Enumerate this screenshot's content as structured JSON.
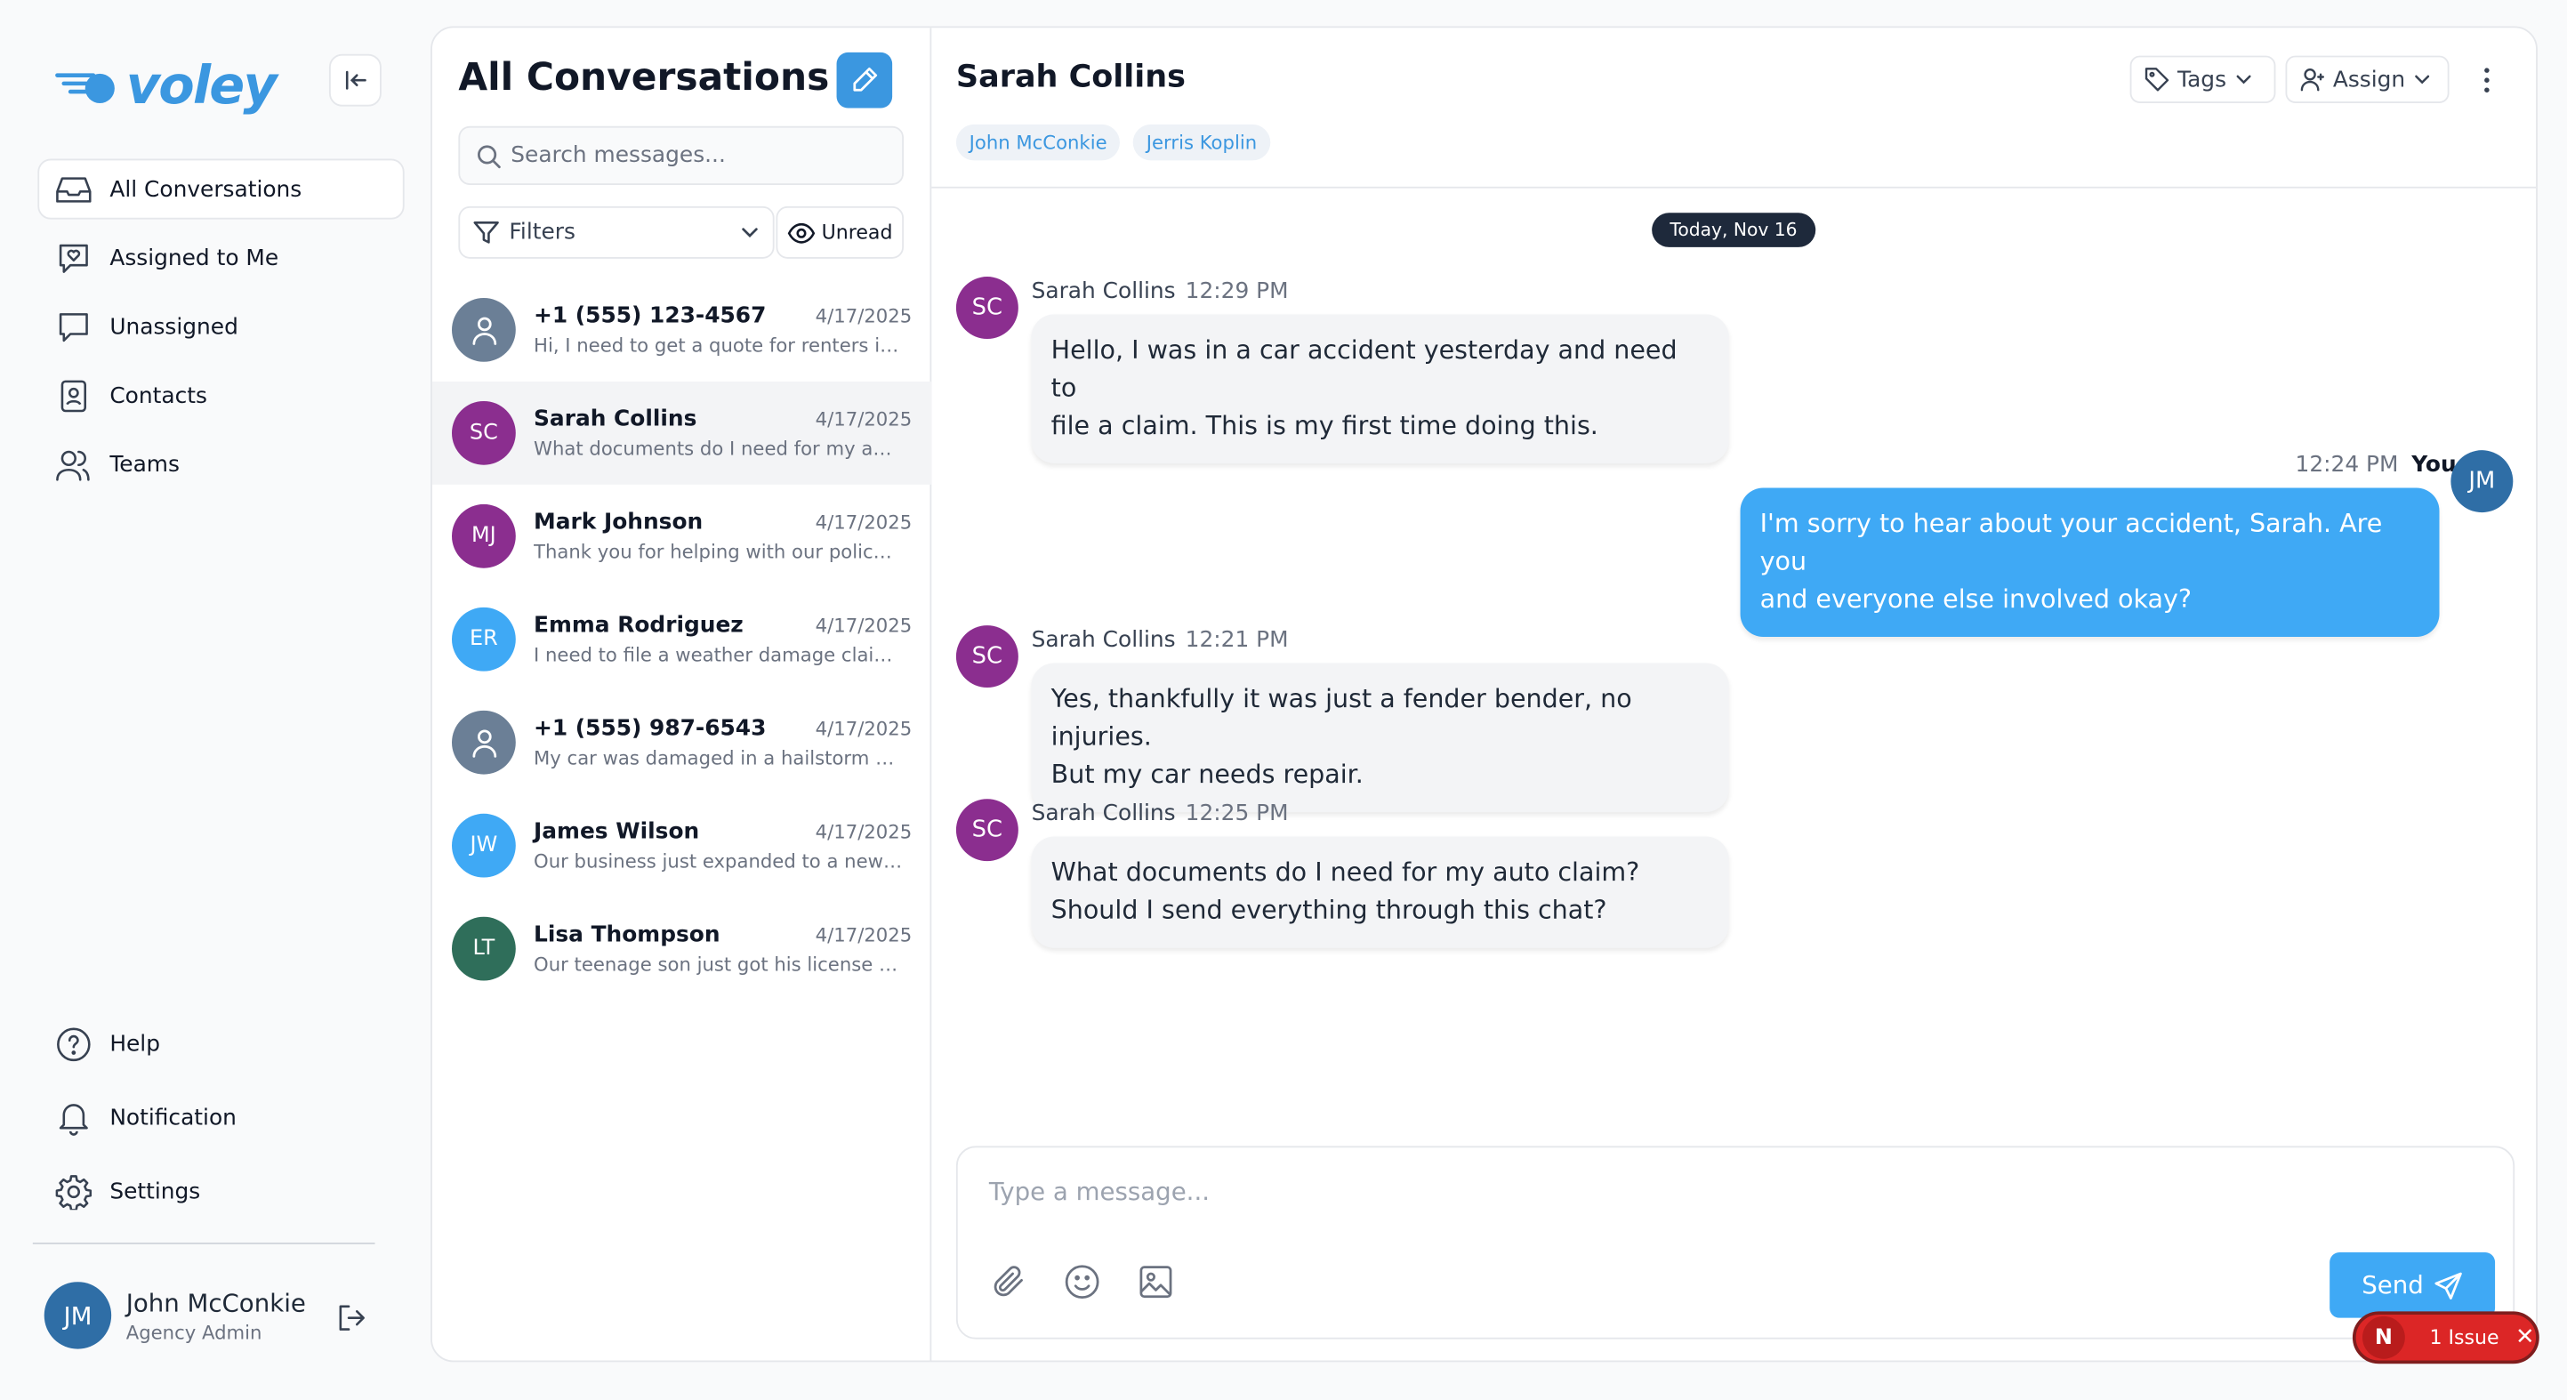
{
  "brand": {
    "name": "voley",
    "color": "#3b97e0"
  },
  "sidebar": {
    "items": [
      {
        "label": "All Conversations",
        "icon": "inbox-icon",
        "active": true
      },
      {
        "label": "Assigned to Me",
        "icon": "chat-heart-icon"
      },
      {
        "label": "Unassigned",
        "icon": "chat-bubble-icon"
      },
      {
        "label": "Contacts",
        "icon": "contact-card-icon"
      },
      {
        "label": "Teams",
        "icon": "users-icon"
      }
    ],
    "bottom": [
      {
        "label": "Help",
        "icon": "help-circle-icon"
      },
      {
        "label": "Notification",
        "icon": "bell-icon"
      },
      {
        "label": "Settings",
        "icon": "gear-icon"
      }
    ]
  },
  "user": {
    "initials": "JM",
    "name": "John McConkie",
    "role": "Agency Admin"
  },
  "conversations": {
    "title": "All Conversations",
    "search_placeholder": "Search messages...",
    "filters_label": "Filters",
    "unread_label": "Unread",
    "items": [
      {
        "initials": "",
        "name": "+1 (555) 123-4567",
        "date": "4/17/2025",
        "preview": "Hi, I need to get a quote for renters insurance",
        "color": "#6b7f96",
        "generic": true
      },
      {
        "initials": "SC",
        "name": "Sarah Collins",
        "date": "4/17/2025",
        "preview": "What documents do I need for my auto claim?",
        "color": "#8b2e8f",
        "selected": true
      },
      {
        "initials": "MJ",
        "name": "Mark Johnson",
        "date": "4/17/2025",
        "preview": "Thank you for helping with our policy update",
        "color": "#8b2e8f"
      },
      {
        "initials": "ER",
        "name": "Emma Rodriguez",
        "date": "4/17/2025",
        "preview": "I need to file a weather damage claim for my roof",
        "color": "#3fa9f5"
      },
      {
        "initials": "",
        "name": "+1 (555) 987-6543",
        "date": "4/17/2025",
        "preview": "My car was damaged in a hailstorm yesterday",
        "color": "#6b7f96",
        "generic": true
      },
      {
        "initials": "JW",
        "name": "James Wilson",
        "date": "4/17/2025",
        "preview": "Our business just expanded to a new location",
        "color": "#3fa9f5"
      },
      {
        "initials": "LT",
        "name": "Lisa Thompson",
        "date": "4/17/2025",
        "preview": "Our teenage son just got his license and we need",
        "color": "#2f6e5a"
      }
    ]
  },
  "chat": {
    "contact_name": "Sarah Collins",
    "tags": [
      "John McConkie",
      "Jerris Koplin"
    ],
    "tags_button": "Tags",
    "assign_button": "Assign",
    "date_divider": "Today, Nov 16",
    "messages": [
      {
        "from": "Sarah Collins",
        "initials": "SC",
        "time": "12:29 PM",
        "lines": [
          "Hello, I was in a car accident yesterday and need to",
          "file a claim. This is my first time doing this."
        ]
      },
      {
        "from": "You",
        "initials": "JM",
        "time": "12:24 PM",
        "lines": [
          "I'm sorry to hear about your accident, Sarah. Are you",
          "and everyone else involved okay?"
        ]
      },
      {
        "from": "Sarah Collins",
        "initials": "SC",
        "time": "12:21 PM",
        "lines": [
          "Yes, thankfully it was just a fender bender, no injuries.",
          "But my car needs repair."
        ]
      },
      {
        "from": "Sarah Collins",
        "initials": "SC",
        "time": "12:25 PM",
        "lines": [
          "What documents do I need for my auto claim?",
          "Should I send everything through this chat?"
        ]
      }
    ],
    "composer_placeholder": "Type a message...",
    "send_label": "Send"
  },
  "issue_badge": {
    "letter": "N",
    "label": "1 Issue"
  }
}
